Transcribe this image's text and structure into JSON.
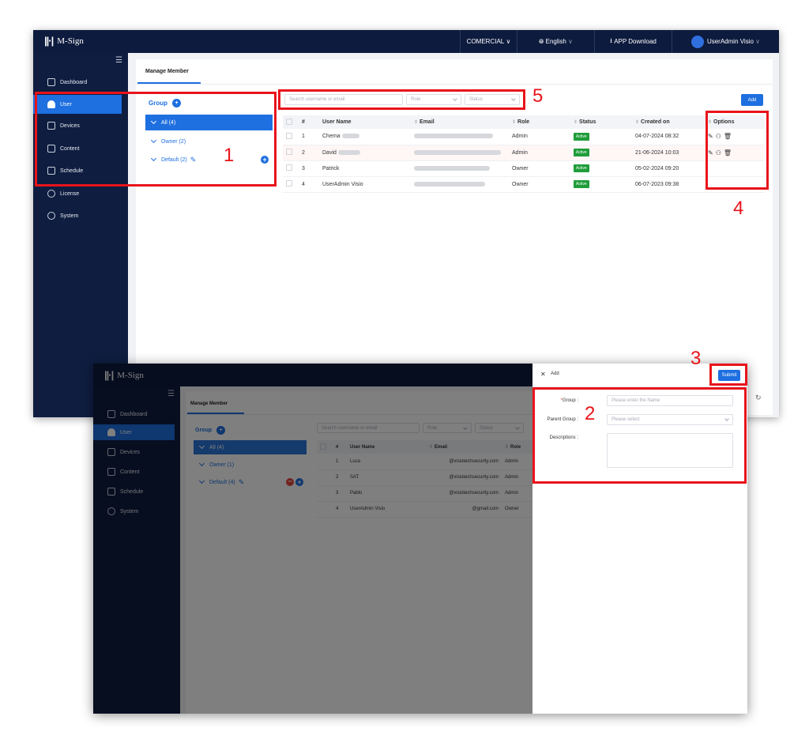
{
  "app": {
    "logo_mark": "||·|",
    "name": "M-Sign"
  },
  "topbar": {
    "company": "COMERCIAL",
    "language": "English",
    "download": "APP Download",
    "user": "UserAdmin Visio"
  },
  "nav": {
    "dashboard": "Dashboard",
    "user": "User",
    "devices": "Devices",
    "content": "Content",
    "schedule": "Schedule",
    "license": "License",
    "system": "System"
  },
  "tab_label": "Manage Member",
  "group_panel": {
    "title": "Group",
    "screen1": {
      "all": "All (4)",
      "owner": "Owner (2)",
      "default": "Default (2)"
    },
    "screen2": {
      "all": "All (4)",
      "owner": "Owner (1)",
      "default": "Default (4)"
    }
  },
  "filters": {
    "search_placeholder": "Search username or email",
    "role": "Role",
    "status": "Status",
    "add_button": "Add"
  },
  "table": {
    "headers": {
      "num": "#",
      "username": "User Name",
      "email": "Email",
      "role": "Role",
      "status": "Status",
      "created": "Created on",
      "options": "Options"
    },
    "rows": [
      {
        "num": "1",
        "username": "Chema",
        "role": "Admin",
        "status": "Active",
        "created": "04-07-2024 08:32"
      },
      {
        "num": "2",
        "username": "David",
        "role": "Admin",
        "status": "Active",
        "created": "21-06-2024 10:03"
      },
      {
        "num": "3",
        "username": "Patrick",
        "role": "Owner",
        "status": "Active",
        "created": "05-02-2024 09:20"
      },
      {
        "num": "4",
        "username": "UserAdmin Visio",
        "role": "Owner",
        "status": "Active",
        "created": "06-07-2023 09:38"
      }
    ],
    "rows2": [
      {
        "num": "1",
        "username": "Luca",
        "email": "@visiotechsecurity.com",
        "role": "Admin"
      },
      {
        "num": "2",
        "username": "SAT",
        "email": "@visiotechsecurity.com",
        "role": "Admin"
      },
      {
        "num": "3",
        "username": "Pablo",
        "email": "@visiotechsecurity.com",
        "role": "Admin"
      },
      {
        "num": "4",
        "username": "UserAdmin Visio",
        "email": "@gmail.com",
        "role": "Owner"
      }
    ]
  },
  "add_panel": {
    "title": "Add",
    "submit": "Submit",
    "group_label": "Group :",
    "group_placeholder": "Please enter the Name",
    "parent_label": "Parent Group :",
    "parent_placeholder": "Please select",
    "desc_label": "Descriptions :"
  },
  "callouts": {
    "c1": "1",
    "c2": "2",
    "c3": "3",
    "c4": "4",
    "c5": "5"
  },
  "colors": {
    "accent": "#1e6fe0",
    "nav_bg": "#0f1d40",
    "callout": "#e8141b",
    "active_badge": "#1f9d3a"
  }
}
